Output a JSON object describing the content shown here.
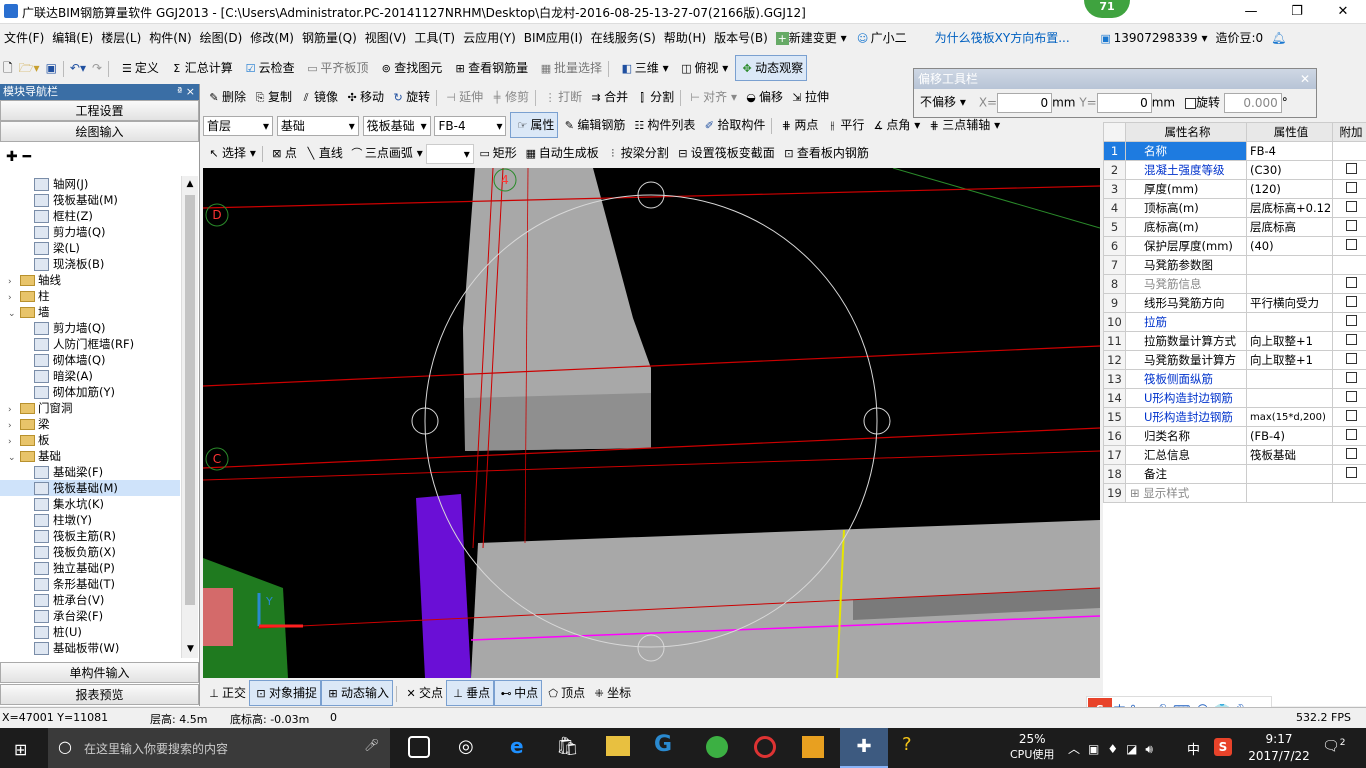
{
  "app": {
    "title": "广联达BIM钢筋算量软件 GGJ2013 - [C:\\Users\\Administrator.PC-20141127NRHM\\Desktop\\白龙村-2016-08-25-13-27-07(2166版).GGJ12]",
    "badge": "71"
  },
  "menu": [
    "文件(F)",
    "编辑(E)",
    "楼层(L)",
    "构件(N)",
    "绘图(D)",
    "修改(M)",
    "钢筋量(Q)",
    "视图(V)",
    "工具(T)",
    "云应用(Y)",
    "BIM应用(I)",
    "在线服务(S)",
    "帮助(H)",
    "版本号(B)",
    "新建变更",
    "广小二",
    "为什么筏板XY方向布置...",
    "13907298339",
    "造价豆:0"
  ],
  "toolbar1": [
    "定义",
    "汇总计算",
    "云检查",
    "平齐板顶",
    "查找图元",
    "查看钢筋量",
    "批量选择",
    "三维",
    "俯视",
    "动态观察"
  ],
  "toolbar2": [
    "删除",
    "复制",
    "镜像",
    "移动",
    "旋转",
    "延伸",
    "修剪",
    "打断",
    "合并",
    "分割",
    "对齐",
    "偏移",
    "拉伸"
  ],
  "toolbar3": {
    "floor": "首层",
    "category": "基础",
    "type": "筏板基础",
    "item": "FB-4",
    "buttons": [
      "属性",
      "编辑钢筋",
      "构件列表",
      "拾取构件",
      "两点",
      "平行",
      "点角",
      "三点辅轴"
    ]
  },
  "toolbar4": [
    "选择",
    "点",
    "直线",
    "三点画弧",
    "矩形",
    "自动生成板",
    "按梁分割",
    "设置筏板变截面",
    "查看板内钢筋"
  ],
  "offset_bar": {
    "title": "偏移工具栏",
    "mode": "不偏移",
    "x_label": "X=",
    "x_value": "0",
    "y_label": "Y=",
    "y_value": "0",
    "unit": "mm",
    "rotate_label": "旋转",
    "rotate_value": "0.000",
    "deg": "°"
  },
  "left_panel": {
    "title": "模块导航栏",
    "pin": "ª ×",
    "section_top": "工程设置",
    "section_draw": "绘图输入",
    "section_single": "单构件输入",
    "section_report": "报表预览",
    "tree": [
      {
        "lvl": 2,
        "label": "轴网(J)"
      },
      {
        "lvl": 2,
        "label": "筏板基础(M)"
      },
      {
        "lvl": 2,
        "label": "框柱(Z)"
      },
      {
        "lvl": 2,
        "label": "剪力墙(Q)"
      },
      {
        "lvl": 2,
        "label": "梁(L)"
      },
      {
        "lvl": 2,
        "label": "现浇板(B)"
      },
      {
        "lvl": 1,
        "exp": "›",
        "label": "轴线"
      },
      {
        "lvl": 1,
        "exp": "›",
        "label": "柱"
      },
      {
        "lvl": 1,
        "exp": "⌄",
        "label": "墙"
      },
      {
        "lvl": 2,
        "label": "剪力墙(Q)"
      },
      {
        "lvl": 2,
        "label": "人防门框墙(RF)"
      },
      {
        "lvl": 2,
        "label": "砌体墙(Q)"
      },
      {
        "lvl": 2,
        "label": "暗梁(A)"
      },
      {
        "lvl": 2,
        "label": "砌体加筋(Y)"
      },
      {
        "lvl": 1,
        "exp": "›",
        "label": "门窗洞"
      },
      {
        "lvl": 1,
        "exp": "›",
        "label": "梁"
      },
      {
        "lvl": 1,
        "exp": "›",
        "label": "板"
      },
      {
        "lvl": 1,
        "exp": "⌄",
        "label": "基础"
      },
      {
        "lvl": 2,
        "label": "基础梁(F)"
      },
      {
        "lvl": 2,
        "label": "筏板基础(M)",
        "sel": true
      },
      {
        "lvl": 2,
        "label": "集水坑(K)"
      },
      {
        "lvl": 2,
        "label": "柱墩(Y)"
      },
      {
        "lvl": 2,
        "label": "筏板主筋(R)"
      },
      {
        "lvl": 2,
        "label": "筏板负筋(X)"
      },
      {
        "lvl": 2,
        "label": "独立基础(P)"
      },
      {
        "lvl": 2,
        "label": "条形基础(T)"
      },
      {
        "lvl": 2,
        "label": "桩承台(V)"
      },
      {
        "lvl": 2,
        "label": "承台梁(F)"
      },
      {
        "lvl": 2,
        "label": "桩(U)"
      },
      {
        "lvl": 2,
        "label": "基础板带(W)"
      }
    ]
  },
  "props": {
    "header_name": "属性名称",
    "header_value": "属性值",
    "header_add": "附加",
    "rows": [
      {
        "n": "1",
        "name": "名称",
        "value": "FB-4",
        "cls": "",
        "chk": false
      },
      {
        "n": "2",
        "name": "混凝土强度等级",
        "value": "(C30)",
        "cls": "blue",
        "chk": true
      },
      {
        "n": "3",
        "name": "厚度(mm)",
        "value": "(120)",
        "cls": "",
        "chk": true
      },
      {
        "n": "4",
        "name": "顶标高(m)",
        "value": "层底标高+0.12",
        "cls": "",
        "chk": true
      },
      {
        "n": "5",
        "name": "底标高(m)",
        "value": "层底标高",
        "cls": "",
        "chk": true
      },
      {
        "n": "6",
        "name": "保护层厚度(mm)",
        "value": "(40)",
        "cls": "",
        "chk": true
      },
      {
        "n": "7",
        "name": "马凳筋参数图",
        "value": "",
        "cls": "",
        "chk": false
      },
      {
        "n": "8",
        "name": "马凳筋信息",
        "value": "",
        "cls": "gray",
        "chk": true
      },
      {
        "n": "9",
        "name": "线形马凳筋方向",
        "value": "平行横向受力",
        "cls": "",
        "chk": true
      },
      {
        "n": "10",
        "name": "拉筋",
        "value": "",
        "cls": "blue",
        "chk": true
      },
      {
        "n": "11",
        "name": "拉筋数量计算方式",
        "value": "向上取整+1",
        "cls": "",
        "chk": true
      },
      {
        "n": "12",
        "name": "马凳筋数量计算方",
        "value": "向上取整+1",
        "cls": "",
        "chk": true
      },
      {
        "n": "13",
        "name": "筏板侧面纵筋",
        "value": "",
        "cls": "blue",
        "chk": true
      },
      {
        "n": "14",
        "name": "U形构造封边钢筋",
        "value": "",
        "cls": "blue",
        "chk": true
      },
      {
        "n": "15",
        "name": "U形构造封边钢筋",
        "value": "max(15*d,200)",
        "cls": "blue",
        "chk": true
      },
      {
        "n": "16",
        "name": "归类名称",
        "value": "(FB-4)",
        "cls": "",
        "chk": true
      },
      {
        "n": "17",
        "name": "汇总信息",
        "value": "筏板基础",
        "cls": "",
        "chk": true
      },
      {
        "n": "18",
        "name": "备注",
        "value": "",
        "cls": "",
        "chk": true
      },
      {
        "n": "19",
        "name": "显示样式",
        "value": "",
        "cls": "gray",
        "chk": false
      }
    ]
  },
  "viewport": {
    "axis_labels": [
      "4",
      "D",
      "C"
    ],
    "axis_y": "Y"
  },
  "snapbar": [
    "正交",
    "对象捕捉",
    "动态输入",
    "交点",
    "垂点",
    "中点",
    "顶点",
    "坐标"
  ],
  "status": {
    "coords": "X=47001 Y=11081",
    "floor_height": "层高: 4.5m",
    "base_elev": "底标高: -0.03m",
    "zero": "0",
    "fps": "532.2 FPS"
  },
  "ime": "中",
  "taskbar": {
    "search_placeholder": "在这里输入你要搜索的内容",
    "cpu": "25%",
    "cpu_label": "CPU使用",
    "lang": "中",
    "time": "9:17",
    "date": "2017/7/22",
    "notif": "2"
  },
  "colors": {
    "accent": "#3a6ea5",
    "viewport_bg": "#000000",
    "axis_red": "#cc0000",
    "slab_gray": "#a8a8a8",
    "column_purple": "#6a0fd6",
    "magenta": "#ff00ff"
  }
}
